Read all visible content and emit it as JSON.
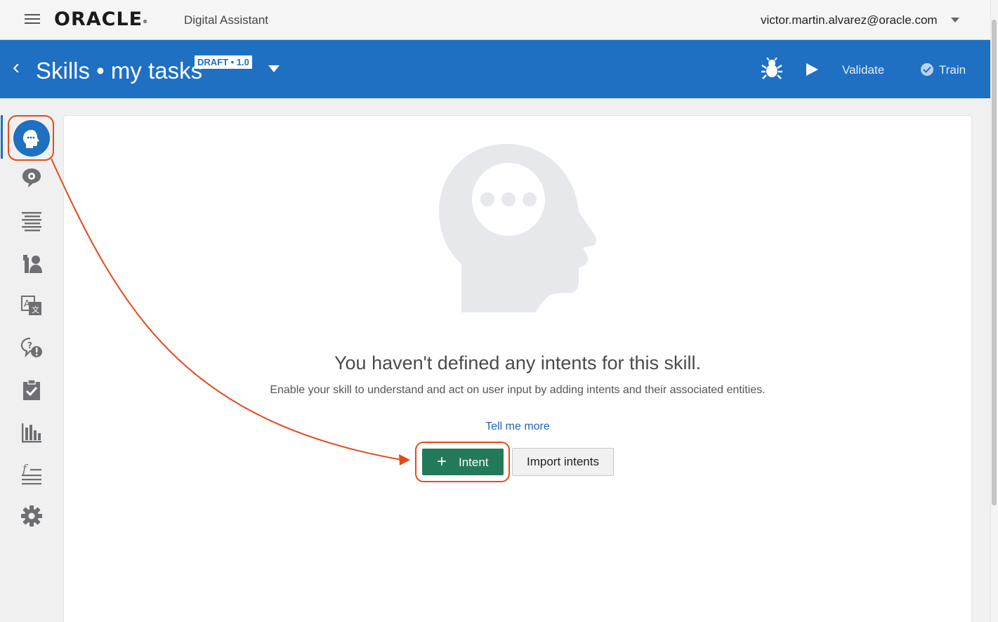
{
  "topbar": {
    "logo_text": "ORACLE",
    "logo_reg": "®",
    "product_name": "Digital Assistant",
    "user_email": "victor.martin.alvarez@oracle.com"
  },
  "skillbar": {
    "back_glyph": "‹",
    "title": "Skills • my tasks",
    "badge": "DRAFT • 1.0",
    "validate_label": "Validate",
    "train_label": "Train"
  },
  "sidebar": {
    "items": [
      {
        "name": "intents-icon",
        "active": true
      },
      {
        "name": "entities-icon"
      },
      {
        "name": "flows-icon"
      },
      {
        "name": "components-icon"
      },
      {
        "name": "resource-bundles-icon"
      },
      {
        "name": "quality-icon"
      },
      {
        "name": "insights-icon"
      },
      {
        "name": "analytics-icon"
      },
      {
        "name": "variables-icon"
      },
      {
        "name": "settings-icon"
      }
    ]
  },
  "main": {
    "empty_title": "You haven't defined any intents for this skill.",
    "empty_description": "Enable your skill to understand and act on user input by adding intents and their associated entities.",
    "tell_me_more": "Tell me more",
    "add_intent_plus": "+",
    "add_intent_label": "Intent",
    "import_label": "Import intents"
  },
  "colors": {
    "brand_blue": "#1f6fc3",
    "primary_green": "#237a5a",
    "annotation_red": "#e64a1a",
    "illustration_gray": "#e6e8eb",
    "link_blue": "#1f62b3"
  }
}
